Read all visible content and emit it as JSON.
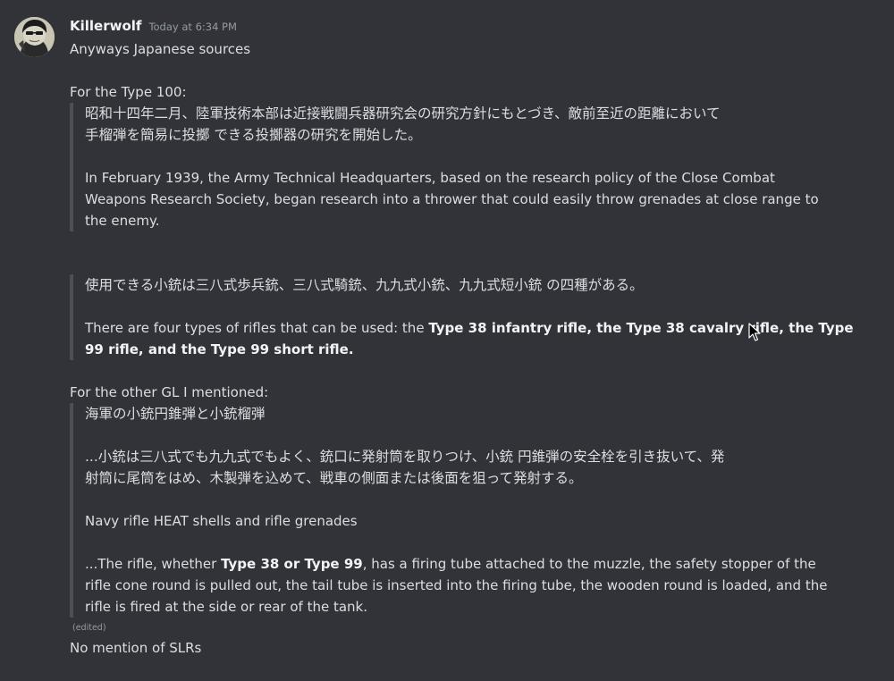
{
  "message": {
    "username": "Killerwolf",
    "timestamp": "Today at 6:34 PM",
    "intro": "Anyways Japanese sources",
    "type100_heading": "For the Type 100:",
    "quote1": {
      "jp_line1": "昭和十四年二月、陸軍技術本部は近接戦闘兵器研究会の研究方針にもとづき、敵前至近の距離において",
      "jp_line2": "手榴弾を簡易に投擲 できる投擲器の研究を開始した。",
      "en_line1": "In February 1939, the Army Technical Headquarters, based on the research policy of the Close Combat",
      "en_line2": "Weapons Research Society, began research into a thrower that could easily throw grenades at close range to",
      "en_line3": "the enemy."
    },
    "quote2": {
      "jp_line1": "使用できる小銃は三八式歩兵銃、三八式騎銃、九九式小銃、九九式短小銃 の四種がある。",
      "en_line1_plain": "There are four types of rifles that can be used: the ",
      "en_line1_bold": "Type 38 infantry rifle, the Type 38 cavalry rifle, the Type",
      "en_line2_bold": "99 rifle, and the Type 99 short rifle."
    },
    "other_gl_heading": "For the other GL I mentioned:",
    "quote3": {
      "jp_title": "海軍の小銃円錐弾と小銃榴弾",
      "jp_line1": "...小銃は三八式でも九九式でもよく、銃口に発射筒を取りつけ、小銃 円錐弾の安全栓を引き抜いて、発",
      "jp_line2": "射筒に尾筒をはめ、木製弾を込めて、戦車の側面または後面を狙って発射する。",
      "en_title": "Navy rifle HEAT shells and rifle grenades",
      "en_line1_pre": "...The rifle, whether ",
      "en_line1_bold": "Type 38 or Type 99",
      "en_line1_post": ", has a firing tube attached to the muzzle, the safety stopper of the",
      "en_line2": "rifle cone round is pulled out, the tail tube is inserted into the firing tube, the wooden round is loaded, and the",
      "en_line3": "rifle is fired at the side or rear of the tank."
    },
    "edited_label": "(edited)",
    "followup": "No mention of SLRs"
  },
  "colors": {
    "background": "#313338",
    "text": "#dbdee1",
    "username": "#f2f3f5",
    "muted": "#949ba4",
    "quote_bar": "#4e5058"
  },
  "icons": {
    "avatar": "avatar",
    "cursor": "mouse-pointer-icon"
  }
}
